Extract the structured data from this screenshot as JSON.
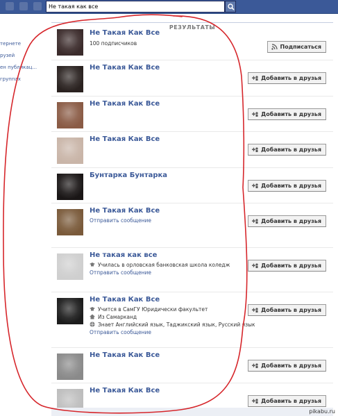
{
  "search": {
    "value": "Не такая как все"
  },
  "left_nav": [
    "тернете",
    "рузей",
    "ен публикац...",
    "группах"
  ],
  "section_header": "РЕЗУЛЬТАТЫ",
  "results": [
    {
      "name": "Не Такая Как Все",
      "subscribers": "100 подписчиков",
      "button": "Подписаться",
      "button_icon": "rss-icon",
      "avatar": "#3b2b2b"
    },
    {
      "name": "Не Такая Как Все",
      "button": "Добавить в друзья",
      "button_icon": "add-friend-icon",
      "avatar": "#2a2220"
    },
    {
      "name": "Не Такая Как Все",
      "button": "Добавить в друзья",
      "button_icon": "add-friend-icon",
      "avatar": "#8a5b45"
    },
    {
      "name": "Не Такая Как Все",
      "button": "Добавить в друзья",
      "button_icon": "add-friend-icon",
      "avatar": "#c9b5a8"
    },
    {
      "name": "Бунтарка Бунтарка",
      "button": "Добавить в друзья",
      "button_icon": "add-friend-icon",
      "avatar": "#1a1616"
    },
    {
      "name": "Не Такая Как Все",
      "message": "Отправить сообщение",
      "button": "Добавить в друзья",
      "button_icon": "add-friend-icon",
      "avatar": "#7a5a3a"
    },
    {
      "name": "Не такая как все",
      "edu": "Училась в орловская банковская школа коледж",
      "message": "Отправить сообщение",
      "button": "Добавить в друзья",
      "button_icon": "add-friend-icon",
      "avatar": "#cfcfcf"
    },
    {
      "name": "Не Такая Как Все",
      "edu": "Учится в СамГУ Юридически факультет",
      "from": "Из Самарканд",
      "languages": "Знает Английский язык, Таджикский язык, Русский язык",
      "message": "Отправить сообщение",
      "button": "Добавить в друзья",
      "button_icon": "add-friend-icon",
      "avatar": "#1c1c1c"
    },
    {
      "name": "Не Такая Как Все",
      "button": "Добавить в друзья",
      "button_icon": "add-friend-icon",
      "avatar": "#8a8a8a"
    },
    {
      "name": "Не Такая Как Все",
      "button": "Добавить в друзья",
      "button_icon": "add-friend-icon",
      "avatar": "#bdbdbd"
    }
  ],
  "watermark": "pikabu.ru",
  "colors": {
    "topbar": "#3b5998",
    "link": "#3b5998",
    "annotation": "#d6262b"
  }
}
